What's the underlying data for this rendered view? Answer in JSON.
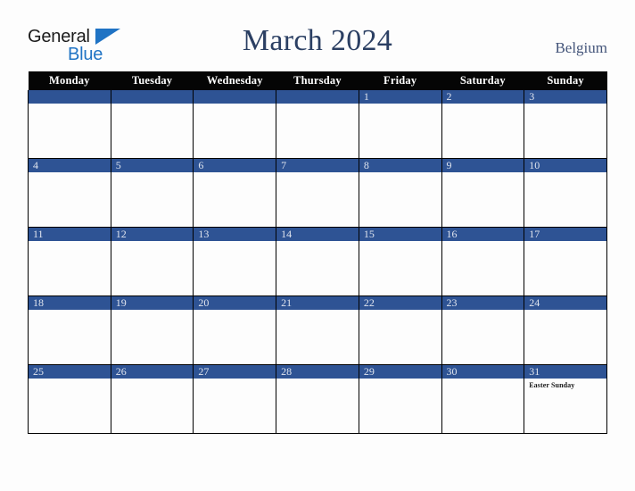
{
  "brand": {
    "name_part1": "General",
    "name_part2": "Blue",
    "triangle_color": "#1f73c4"
  },
  "header": {
    "title": "March 2024",
    "country": "Belgium",
    "title_color": "#2b3f63",
    "country_color": "#44557a"
  },
  "calendar": {
    "weekday_headers": [
      "Monday",
      "Tuesday",
      "Wednesday",
      "Thursday",
      "Friday",
      "Saturday",
      "Sunday"
    ],
    "header_bg": "#050505",
    "daybar_bg": "#2e5394",
    "daybar_text_color": "#dfe4ee",
    "weeks": [
      [
        {
          "day": "",
          "events": []
        },
        {
          "day": "",
          "events": []
        },
        {
          "day": "",
          "events": []
        },
        {
          "day": "",
          "events": []
        },
        {
          "day": "1",
          "events": []
        },
        {
          "day": "2",
          "events": []
        },
        {
          "day": "3",
          "events": []
        }
      ],
      [
        {
          "day": "4",
          "events": []
        },
        {
          "day": "5",
          "events": []
        },
        {
          "day": "6",
          "events": []
        },
        {
          "day": "7",
          "events": []
        },
        {
          "day": "8",
          "events": []
        },
        {
          "day": "9",
          "events": []
        },
        {
          "day": "10",
          "events": []
        }
      ],
      [
        {
          "day": "11",
          "events": []
        },
        {
          "day": "12",
          "events": []
        },
        {
          "day": "13",
          "events": []
        },
        {
          "day": "14",
          "events": []
        },
        {
          "day": "15",
          "events": []
        },
        {
          "day": "16",
          "events": []
        },
        {
          "day": "17",
          "events": []
        }
      ],
      [
        {
          "day": "18",
          "events": []
        },
        {
          "day": "19",
          "events": []
        },
        {
          "day": "20",
          "events": []
        },
        {
          "day": "21",
          "events": []
        },
        {
          "day": "22",
          "events": []
        },
        {
          "day": "23",
          "events": []
        },
        {
          "day": "24",
          "events": []
        }
      ],
      [
        {
          "day": "25",
          "events": []
        },
        {
          "day": "26",
          "events": []
        },
        {
          "day": "27",
          "events": []
        },
        {
          "day": "28",
          "events": []
        },
        {
          "day": "29",
          "events": []
        },
        {
          "day": "30",
          "events": []
        },
        {
          "day": "31",
          "events": [
            "Easter Sunday"
          ]
        }
      ]
    ]
  }
}
